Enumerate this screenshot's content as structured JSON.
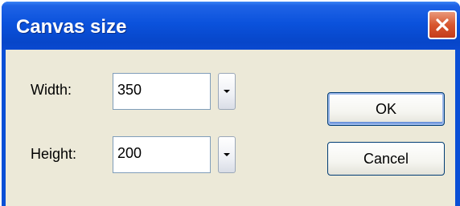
{
  "dialog": {
    "title": "Canvas size"
  },
  "fields": {
    "width_label": "Width:",
    "width_value": "350",
    "height_label": "Height:",
    "height_value": "200"
  },
  "buttons": {
    "ok_label": "OK",
    "cancel_label": "Cancel"
  },
  "icons": {
    "close": "close-icon",
    "dropdown": "chevron-down-icon"
  },
  "colors": {
    "titlebar": "#0b52dc",
    "close_button": "#d8572f",
    "client": "#ece9d8"
  }
}
